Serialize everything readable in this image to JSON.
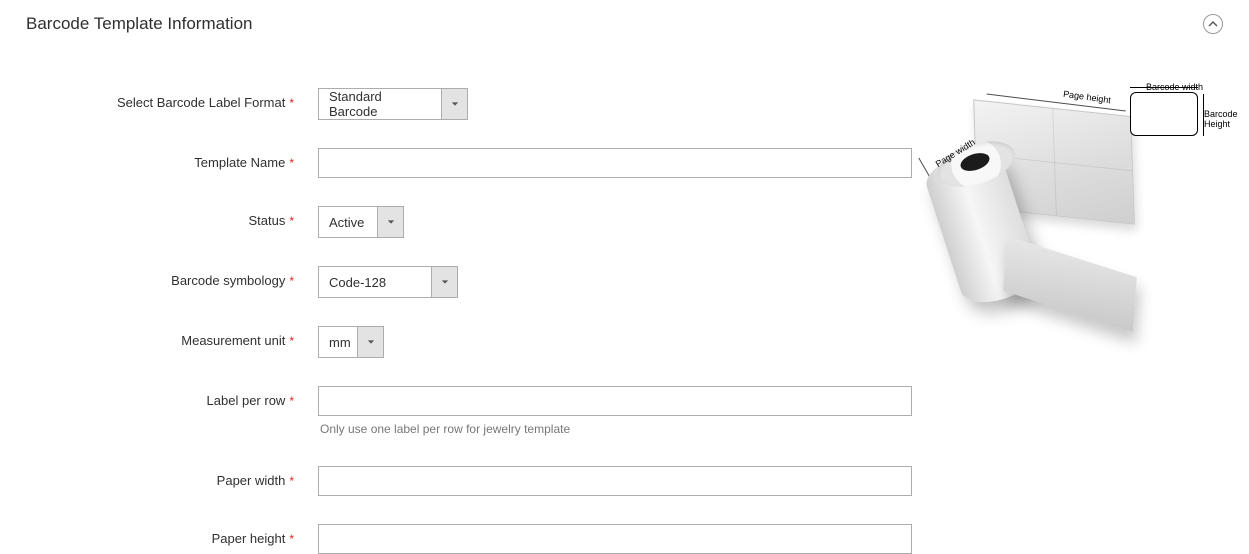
{
  "fieldset": {
    "title": "Barcode Template Information"
  },
  "fields": {
    "format": {
      "label": "Select Barcode Label Format",
      "value": "Standard Barcode"
    },
    "name": {
      "label": "Template Name",
      "value": ""
    },
    "status": {
      "label": "Status",
      "value": "Active"
    },
    "symbology": {
      "label": "Barcode symbology",
      "value": "Code-128"
    },
    "unit": {
      "label": "Measurement unit",
      "value": "mm"
    },
    "perrow": {
      "label": "Label per row",
      "value": "",
      "note": "Only use one label per row for jewelry template"
    },
    "pwidth": {
      "label": "Paper width",
      "value": ""
    },
    "pheight": {
      "label": "Paper height",
      "value": ""
    }
  },
  "diagram": {
    "page_width_label": "Page width",
    "page_height_label": "Page height",
    "barcode_width_label": "Barcode width",
    "barcode_height_label": "Barcode\nHeight"
  }
}
